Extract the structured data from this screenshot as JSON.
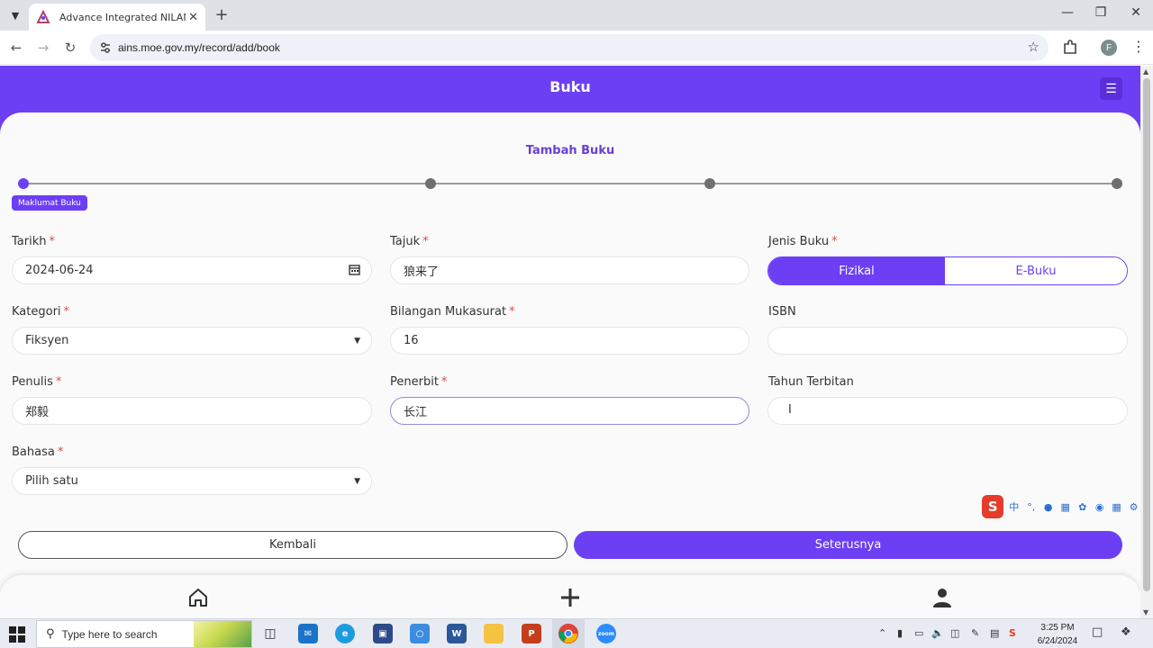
{
  "browser": {
    "tab_title": "Advance Integrated NILAM Sys",
    "url": "ains.moe.gov.my/record/add/book",
    "profile_initial": "F"
  },
  "app": {
    "header_title": "Buku",
    "form_title": "Tambah Buku",
    "step_badge": "Maklumat Buku",
    "accent_color": "#6c3ff5"
  },
  "form": {
    "tarikh": {
      "label": "Tarikh",
      "required": "*",
      "value": "2024-06-24"
    },
    "tajuk": {
      "label": "Tajuk",
      "required": "*",
      "value": "狼来了"
    },
    "jenis_buku": {
      "label": "Jenis Buku",
      "required": "*",
      "options": [
        "Fizikal",
        "E-Buku"
      ],
      "selected": "Fizikal"
    },
    "kategori": {
      "label": "Kategori",
      "required": "*",
      "value": "Fiksyen"
    },
    "bilangan_mukasurat": {
      "label": "Bilangan Mukasurat",
      "required": "*",
      "value": "16"
    },
    "isbn": {
      "label": "ISBN",
      "value": ""
    },
    "penulis": {
      "label": "Penulis",
      "required": "*",
      "value": "郑毅"
    },
    "penerbit": {
      "label": "Penerbit",
      "required": "*",
      "value": "长江"
    },
    "tahun_terbitan": {
      "label": "Tahun Terbitan",
      "value": ""
    },
    "bahasa": {
      "label": "Bahasa",
      "required": "*",
      "value": "Pilih satu"
    }
  },
  "buttons": {
    "back": "Kembali",
    "next": "Seterusnya"
  },
  "ime": {
    "mode": "中"
  },
  "taskbar": {
    "search_placeholder": "Type here to search",
    "time": "3:25 PM",
    "date": "6/24/2024"
  }
}
